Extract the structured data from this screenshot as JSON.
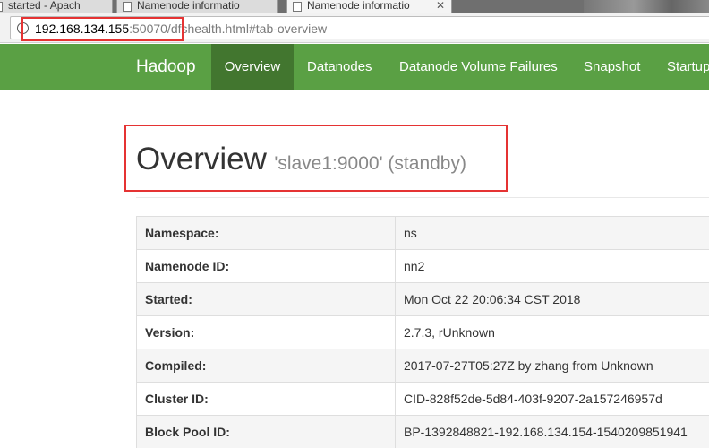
{
  "browser": {
    "tabs": [
      {
        "label": "started - Apach",
        "active": false
      },
      {
        "label": "Namenode informatio",
        "active": false
      },
      {
        "label": "Namenode informatio",
        "active": true
      }
    ],
    "address": {
      "host": "192.168.134.155",
      "rest": ":50070/dfshealth.html#tab-overview"
    }
  },
  "navbar": {
    "brand": "Hadoop",
    "items": [
      {
        "label": "Overview",
        "active": true
      },
      {
        "label": "Datanodes",
        "active": false
      },
      {
        "label": "Datanode Volume Failures",
        "active": false
      },
      {
        "label": "Snapshot",
        "active": false
      },
      {
        "label": "Startup",
        "active": false
      }
    ]
  },
  "page": {
    "title": "Overview",
    "subtitle": "'slave1:9000' (standby)"
  },
  "info_table": {
    "rows": [
      {
        "key": "Namespace:",
        "value": "ns"
      },
      {
        "key": "Namenode ID:",
        "value": "nn2"
      },
      {
        "key": "Started:",
        "value": "Mon Oct 22 20:06:34 CST 2018"
      },
      {
        "key": "Version:",
        "value": "2.7.3, rUnknown"
      },
      {
        "key": "Compiled:",
        "value": "2017-07-27T05:27Z by zhang from Unknown"
      },
      {
        "key": "Cluster ID:",
        "value": "CID-828f52de-5d84-403f-9207-2a157246957d"
      },
      {
        "key": "Block Pool ID:",
        "value": "BP-1392848821-192.168.134.154-1540209851941"
      }
    ]
  },
  "colors": {
    "navbar": "#5aa044",
    "navbar_active": "#42762f",
    "highlight": "#e53333"
  }
}
